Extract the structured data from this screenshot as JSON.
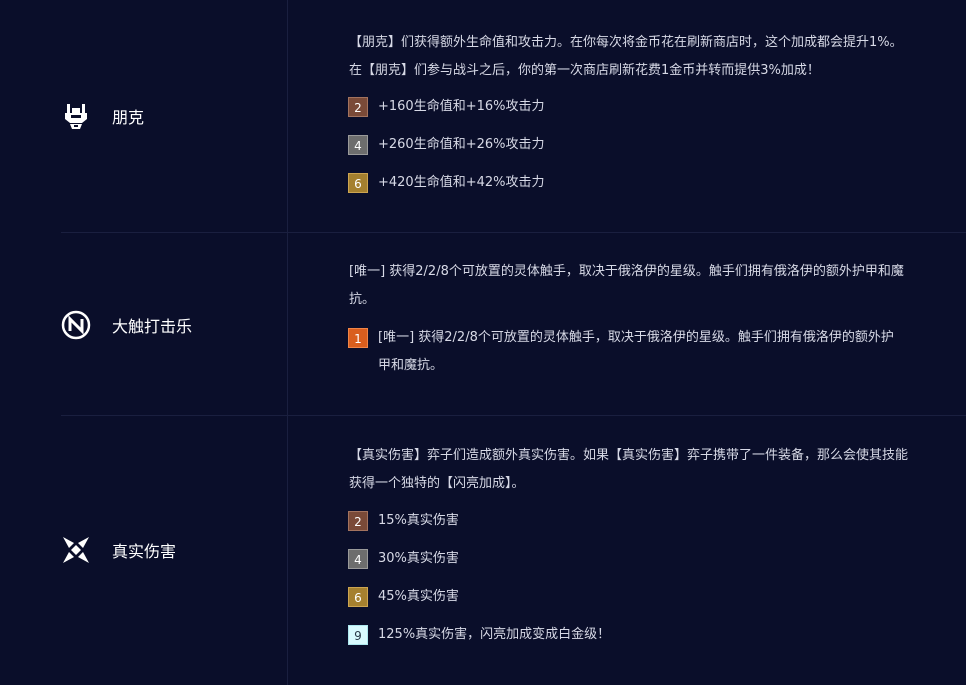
{
  "traits": [
    {
      "name": "朋克",
      "icon": "punk-hand-icon",
      "description": "【朋克】们获得额外生命值和攻击力。在你每次将金币花在刷新商店时，这个加成都会提升1%。在【朋克】们参与战斗之后，你的第一次商店刷新花费1金币并转而提供3%加成！",
      "tiers": [
        {
          "level": "2",
          "tier": "bronze",
          "text": "+160生命值和+16%攻击力"
        },
        {
          "level": "4",
          "tier": "silver",
          "text": "+260生命值和+26%攻击力"
        },
        {
          "level": "6",
          "tier": "gold",
          "text": "+420生命值和+42%攻击力"
        }
      ]
    },
    {
      "name": "大触打击乐",
      "icon": "big-shot-n-icon",
      "description": "[唯一] 获得2/2/8个可放置的灵体触手，取决于俄洛伊的星级。触手们拥有俄洛伊的额外护甲和魔抗。",
      "tiers": [
        {
          "level": "1",
          "tier": "orange",
          "text": "[唯一] 获得2/2/8个可放置的灵体触手，取决于俄洛伊的星级。触手们拥有俄洛伊的额外护甲和魔抗。"
        }
      ]
    },
    {
      "name": "真实伤害",
      "icon": "true-damage-x-icon",
      "description": "【真实伤害】弈子们造成额外真实伤害。如果【真实伤害】弈子携带了一件装备，那么会使其技能获得一个独特的【闪亮加成】。",
      "tiers": [
        {
          "level": "2",
          "tier": "bronze",
          "text": "15%真实伤害"
        },
        {
          "level": "4",
          "tier": "silver",
          "text": "30%真实伤害"
        },
        {
          "level": "6",
          "tier": "gold",
          "text": "45%真实伤害"
        },
        {
          "level": "9",
          "tier": "prismatic",
          "text": "125%真实伤害，闪亮加成变成白金级！"
        }
      ]
    }
  ]
}
